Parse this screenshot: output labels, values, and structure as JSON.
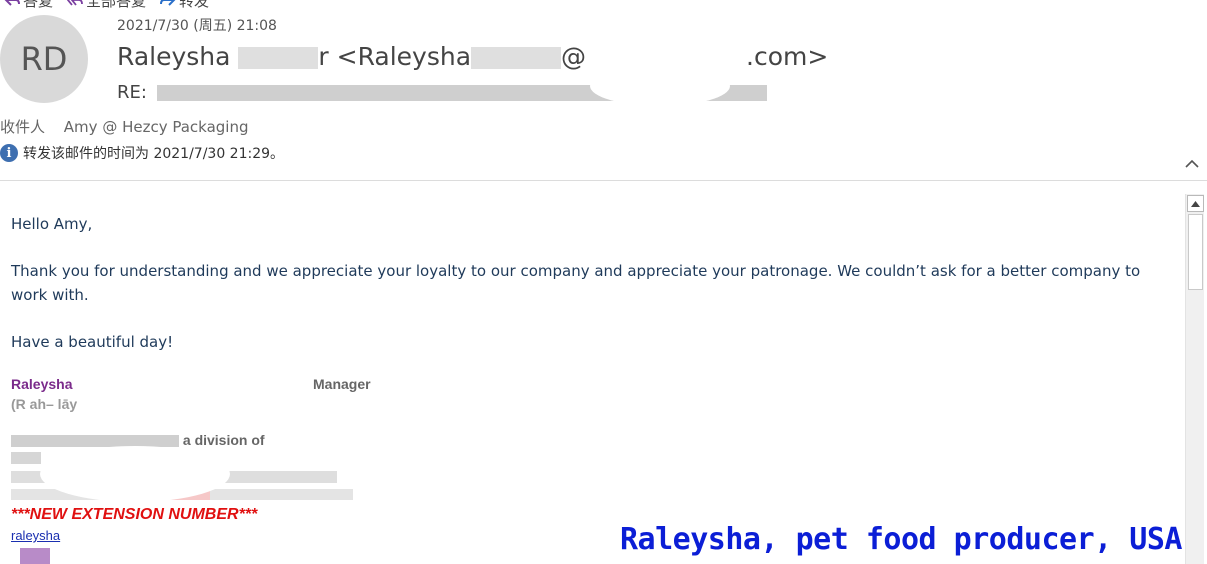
{
  "toolbar": {
    "reply": "答复",
    "reply_all": "全部答复",
    "forward": "转发"
  },
  "header": {
    "avatar_initials": "RD",
    "date": "2021/7/30 (周五) 21:08",
    "sender_first": "Raleysha",
    "sender_last_tail": "r",
    "sender_email_open": "<Raleysha",
    "sender_email_at": "@",
    "sender_email_tail": ".com>",
    "subject_prefix": "RE:",
    "recipient_label": "收件人",
    "recipient": "Amy @ Hezcy Packaging",
    "forward_info": "转发该邮件的时间为 2021/7/30 21:29。"
  },
  "body": {
    "greeting": "Hello Amy,",
    "paragraph": "Thank you for understanding and we appreciate your loyalty to our company and appreciate your patronage. We couldn’t ask for a better company to work with.",
    "closing": "Have a beautiful day!"
  },
  "signature": {
    "name": "Raleysha",
    "title": "Manager",
    "pronunciation": "(R ah– lāy",
    "division": "a division of",
    "extension_notice": "***NEW EXTENSION NUMBER***",
    "email_partial": "raleysha"
  },
  "caption": "Raleysha, pet food producer, USA",
  "colors": {
    "link": "#1a2fb0",
    "caption": "#0b1ed6",
    "notice": "#e01010",
    "sig_name": "#7b2b8b",
    "info_icon": "#3e6fb0"
  },
  "icons": [
    "reply-icon",
    "reply-all-icon",
    "forward-icon",
    "info-icon",
    "collapse-icon",
    "scroll-up-icon"
  ]
}
